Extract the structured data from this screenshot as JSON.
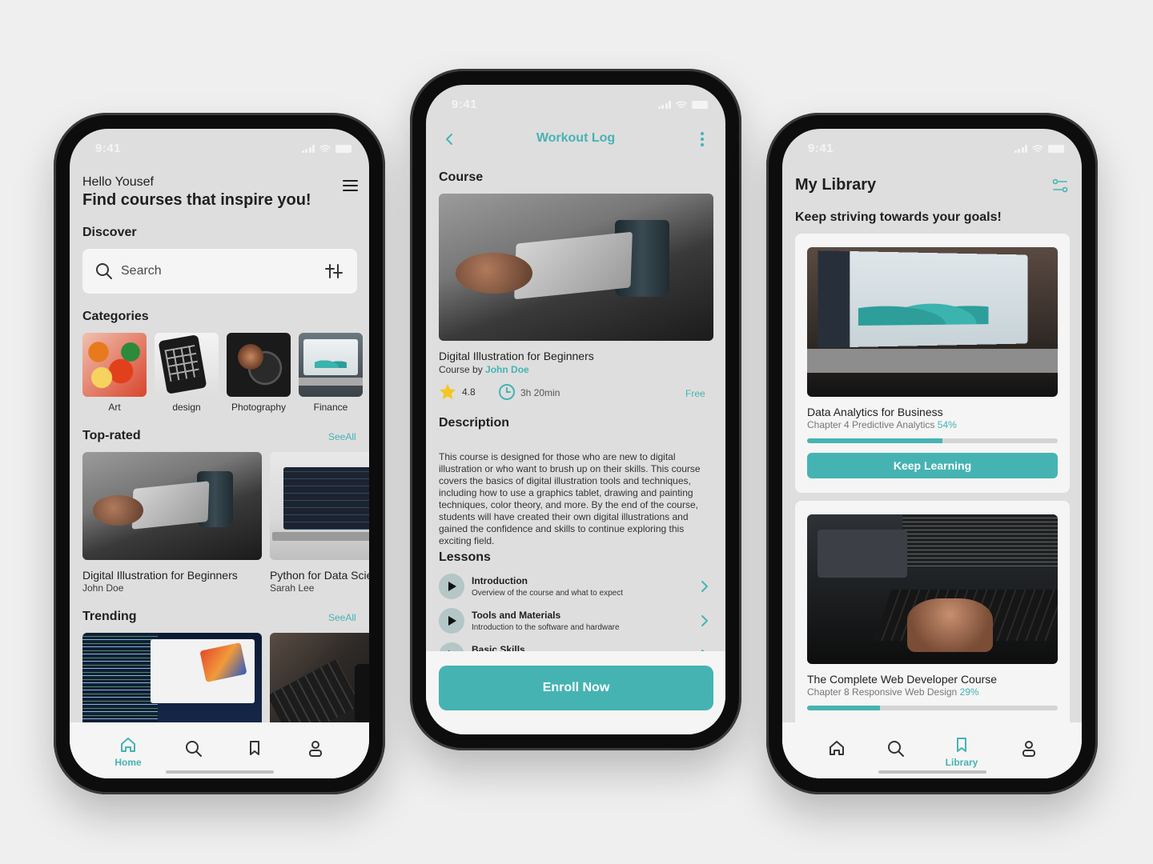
{
  "colors": {
    "accent": "#46b3b3",
    "background": "#efefef",
    "screen": "#dedede",
    "card": "#f5f5f5"
  },
  "status": {
    "time": "9:41"
  },
  "home": {
    "greeting": "Hello Yousef",
    "headline": "Find courses that inspire you!",
    "discover_title": "Discover",
    "search_placeholder": "Search",
    "categories_title": "Categories",
    "categories": [
      {
        "label": "Art",
        "icon": "art-image"
      },
      {
        "label": "design",
        "icon": "design-image"
      },
      {
        "label": "Photography",
        "icon": "photography-image"
      },
      {
        "label": "Finance",
        "icon": "finance-image"
      }
    ],
    "top_rated_title": "Top-rated",
    "top_rated_see_all": "SeeAll",
    "top_rated": [
      {
        "title": "Digital Illustration for Beginners",
        "author": "John Doe"
      },
      {
        "title": "Python for Data Science",
        "author": "Sarah Lee"
      }
    ],
    "trending_title": "Trending",
    "trending_see_all": "SeeAll",
    "tabbar": {
      "home": "Home"
    }
  },
  "detail": {
    "header_title": "Workout Log",
    "section_course": "Course",
    "course_title": "Digital Illustration for Beginners",
    "course_by": "Course by",
    "author": "John Doe",
    "rating": "4.8",
    "duration": "3h 20min",
    "price": "Free",
    "description_title": "Description",
    "description": "This course is designed for those who are new to digital illustration or who want to brush up on their skills. This course covers the basics of digital illustration tools and techniques, including how to use a graphics tablet, drawing and painting techniques, color theory, and more. By the end of the course, students will have created their own digital illustrations and gained the confidence and skills to continue exploring this exciting field.",
    "lessons_title": "Lessons",
    "lessons": [
      {
        "title": "Introduction",
        "subtitle": "Overview of the course and what to expect"
      },
      {
        "title": "Tools and Materials",
        "subtitle": "Introduction to the software and hardware"
      },
      {
        "title": "Basic Skills",
        "subtitle": ""
      }
    ],
    "enroll_label": "Enroll Now"
  },
  "library": {
    "title": "My Library",
    "subtitle": "Keep striving towards your goals!",
    "courses": [
      {
        "title": "Data Analytics for Business",
        "chapter": "Chapter 4 Predictive Analytics",
        "percent_label": "54%",
        "progress": 0.54,
        "button": "Keep Learning"
      },
      {
        "title": "The Complete Web Developer Course",
        "chapter": "Chapter 8 Responsive Web Design",
        "percent_label": "29%",
        "progress": 0.29
      }
    ],
    "tabbar": {
      "library": "Library"
    }
  }
}
